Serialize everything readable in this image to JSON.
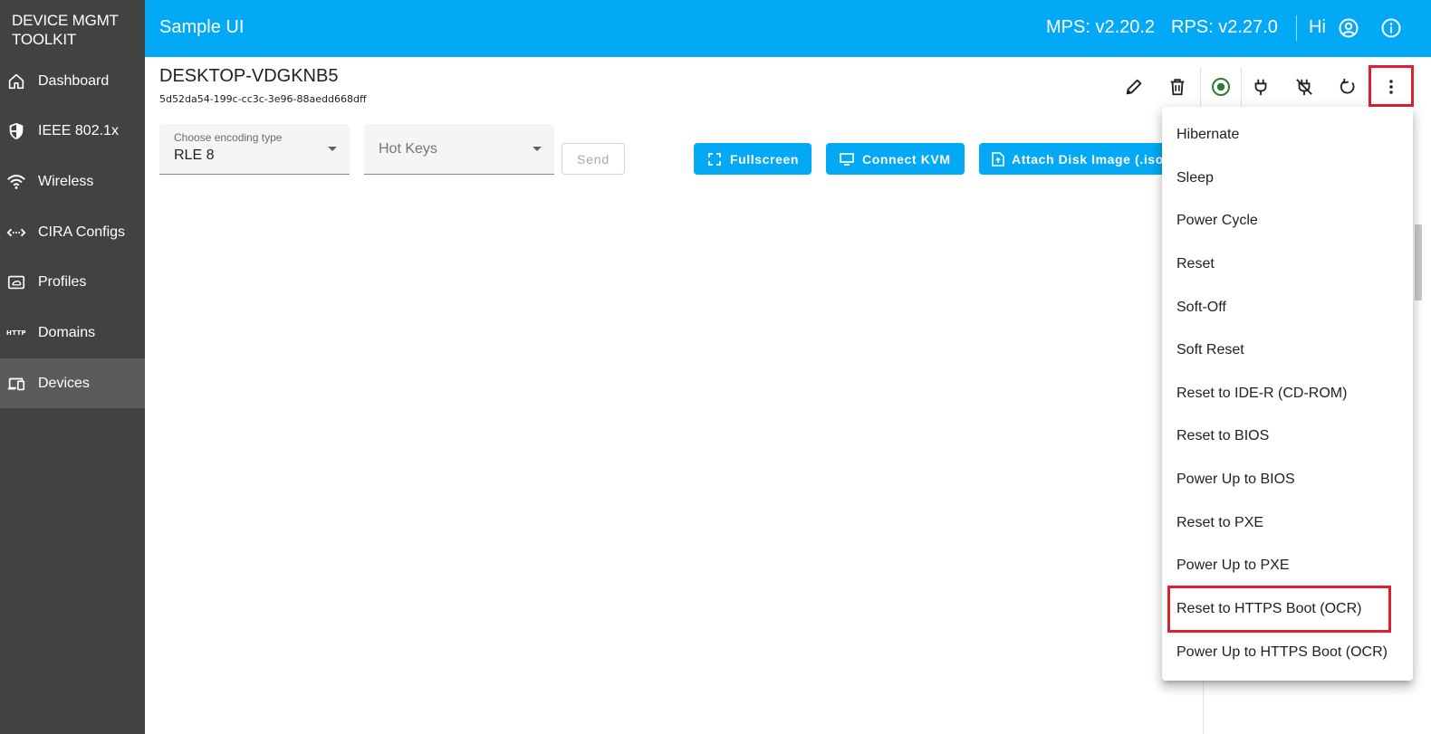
{
  "brand": {
    "line1": "DEVICE MGMT",
    "line2": "TOOLKIT"
  },
  "sidebar": {
    "items": [
      {
        "label": "Dashboard",
        "icon": "home-icon"
      },
      {
        "label": "IEEE 802.1x",
        "icon": "shield-icon"
      },
      {
        "label": "Wireless",
        "icon": "wifi-icon"
      },
      {
        "label": "CIRA Configs",
        "icon": "code-arrows-icon"
      },
      {
        "label": "Profiles",
        "icon": "cloud-box-icon"
      },
      {
        "label": "Domains",
        "icon": "http-icon",
        "icon_text": "HTTP"
      },
      {
        "label": "Devices",
        "icon": "devices-icon",
        "active": true
      }
    ]
  },
  "topbar": {
    "title": "Sample UI",
    "mps": "MPS: v2.20.2",
    "rps": "RPS: v2.27.0",
    "greeting": "Hi"
  },
  "device": {
    "name": "DESKTOP-VDGKNB5",
    "guid": "5d52da54-199c-cc3c-3e96-88aedd668dff"
  },
  "toolbar": {
    "icons": [
      "edit-icon",
      "delete-icon",
      "power-status-icon",
      "plug-icon",
      "unplug-icon",
      "reset-icon",
      "more-vert-icon"
    ]
  },
  "encoding": {
    "label": "Choose encoding type",
    "value": "RLE 8"
  },
  "hotkeys": {
    "placeholder": "Hot Keys"
  },
  "buttons": {
    "send": "Send",
    "fullscreen": "Fullscreen",
    "connect_kvm": "Connect KVM",
    "attach_disk": "Attach Disk Image (.iso)"
  },
  "menu": {
    "items": [
      "Hibernate",
      "Sleep",
      "Power Cycle",
      "Reset",
      "Soft-Off",
      "Soft Reset",
      "Reset to IDE-R (CD-ROM)",
      "Reset to BIOS",
      "Power Up to BIOS",
      "Reset to PXE",
      "Power Up to PXE",
      "Reset to HTTPS Boot (OCR)",
      "Power Up to HTTPS Boot (OCR)"
    ]
  },
  "colors": {
    "primary": "#03a9f4",
    "sidebar": "#424242",
    "highlight": "#e0202e",
    "status_green": "#2e7d32"
  }
}
